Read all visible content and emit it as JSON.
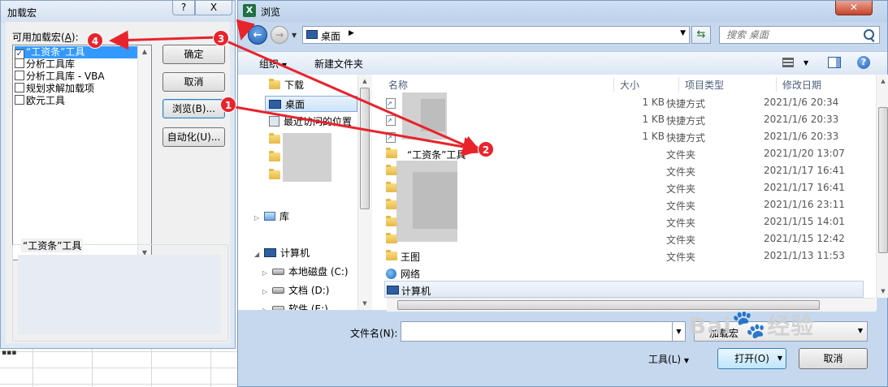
{
  "addin_dialog": {
    "title": "加载宏",
    "help_label": "?",
    "close_label": "X",
    "available_label_prefix": "可用加载宏(",
    "available_label_key": "A",
    "available_label_suffix": "):",
    "items": [
      {
        "label": "“工资条”工具",
        "checked": true,
        "selected": true
      },
      {
        "label": "分析工具库",
        "checked": false,
        "selected": false
      },
      {
        "label": "分析工具库 - VBA",
        "checked": false,
        "selected": false
      },
      {
        "label": "规划求解加载项",
        "checked": false,
        "selected": false
      },
      {
        "label": "欧元工具",
        "checked": false,
        "selected": false
      }
    ],
    "ok_label": "确定",
    "cancel_label": "取消",
    "browse_label": "浏览(B)...",
    "automation_label": "自动化(U)...",
    "description_title": "“工资条”工具"
  },
  "browse_dialog": {
    "title": "浏览",
    "app_icon_letter": "X",
    "address_text": "桌面",
    "search_placeholder": "搜索 桌面",
    "toolbar": {
      "organize": "组织",
      "new_folder": "新建文件夹"
    },
    "nav_items": [
      {
        "label": "下载",
        "icon": "folder-icon"
      },
      {
        "label": "桌面",
        "icon": "desktop-icon",
        "selected": true
      },
      {
        "label": "最近访问的位置",
        "icon": "recent-icon"
      },
      {
        "label": "库",
        "icon": "library-icon"
      },
      {
        "label": "计算机",
        "icon": "computer-icon"
      },
      {
        "label": "本地磁盘 (C:)",
        "icon": "disk-icon"
      },
      {
        "label": "文档 (D:)",
        "icon": "disk-icon"
      },
      {
        "label": "软件 (E:)",
        "icon": "disk-icon"
      }
    ],
    "columns": {
      "name": "名称",
      "size": "大小",
      "type": "项目类型",
      "date": "修改日期"
    },
    "files": [
      {
        "name": "",
        "size": "1 KB",
        "type": "快捷方式",
        "date": "2021/1/6 20:34",
        "icon": "shortcut-icon"
      },
      {
        "name": "",
        "size": "1 KB",
        "type": "快捷方式",
        "date": "2021/1/6 20:33",
        "icon": "shortcut-icon"
      },
      {
        "name": "",
        "size": "1 KB",
        "type": "快捷方式",
        "date": "2021/1/6 20:33",
        "icon": "shortcut-icon"
      },
      {
        "name": "“工资条”工具",
        "size": "",
        "type": "文件夹",
        "date": "2021/1/20 13:07",
        "icon": "folder-icon"
      },
      {
        "name": "",
        "size": "",
        "type": "文件夹",
        "date": "2021/1/17 16:41",
        "icon": "folder-icon"
      },
      {
        "name": "",
        "size": "",
        "type": "文件夹",
        "date": "2021/1/17 16:41",
        "icon": "folder-icon"
      },
      {
        "name": "",
        "size": "",
        "type": "文件夹",
        "date": "2021/1/16 23:11",
        "icon": "folder-icon"
      },
      {
        "name": "",
        "size": "",
        "type": "文件夹",
        "date": "2021/1/15 14:01",
        "icon": "folder-icon"
      },
      {
        "name": "",
        "size": "",
        "type": "文件夹",
        "date": "2021/1/15 12:42",
        "icon": "folder-icon"
      },
      {
        "name": "王图",
        "size": "",
        "type": "文件夹",
        "date": "2021/1/13 11:53",
        "icon": "folder-icon"
      },
      {
        "name": "网络",
        "size": "",
        "type": "",
        "date": "",
        "icon": "network-icon"
      },
      {
        "name": "计算机",
        "size": "",
        "type": "",
        "date": "",
        "icon": "computer-icon"
      }
    ],
    "filename_label": "文件名(N):",
    "filename_value": "",
    "filter_value": "加载宏",
    "tools_label": "工具(L)",
    "open_label": "打开(O)",
    "cancel_label": "取消"
  },
  "annotations": {
    "badges": [
      "1",
      "2",
      "3",
      "4"
    ],
    "color": "#e8232c"
  },
  "watermark": {
    "brand": "Bai",
    "suffix": "经验"
  }
}
